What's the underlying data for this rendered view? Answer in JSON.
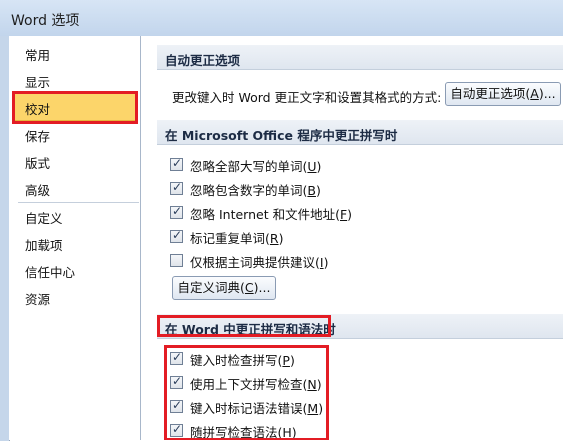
{
  "window": {
    "title": "Word 选项"
  },
  "nav": {
    "items": [
      {
        "label": "常用"
      },
      {
        "label": "显示"
      },
      {
        "label": "校对"
      },
      {
        "label": "保存"
      },
      {
        "label": "版式"
      },
      {
        "label": "高级"
      },
      {
        "label": "自定义"
      },
      {
        "label": "加载项"
      },
      {
        "label": "信任中心"
      },
      {
        "label": "资源"
      }
    ],
    "selected": "校对"
  },
  "autocorrect": {
    "header": "自动更正选项",
    "description": "更改键入时 Word 更正文字和设置其格式的方式:",
    "button": {
      "label": "自动更正选项(A)...",
      "text": "自动更正选项(",
      "key": "A",
      "tail": ")..."
    }
  },
  "office_spelling": {
    "header": "在 Microsoft Office 程序中更正拼写时",
    "options": [
      {
        "text": "忽略全部大写的单词(",
        "key": "U",
        "tail": ")",
        "checked": true
      },
      {
        "text": "忽略包含数字的单词(",
        "key": "B",
        "tail": ")",
        "checked": true
      },
      {
        "text": "忽略 Internet 和文件地址(",
        "key": "F",
        "tail": ")",
        "checked": true
      },
      {
        "text": "标记重复单词(",
        "key": "R",
        "tail": ")",
        "checked": true
      },
      {
        "text": "仅根据主词典提供建议(",
        "key": "I",
        "tail": ")",
        "checked": false
      }
    ],
    "dict_button": {
      "text": "自定义词典(",
      "key": "C",
      "tail": ")..."
    }
  },
  "word_spelling": {
    "header": "在 Word 中更正拼写和语法时",
    "options": [
      {
        "text": "键入时检查拼写(",
        "key": "P",
        "tail": ")",
        "checked": true
      },
      {
        "text": "使用上下文拼写检查(",
        "key": "N",
        "tail": ")",
        "checked": true
      },
      {
        "text": "键入时标记语法错误(",
        "key": "M",
        "tail": ")",
        "checked": true
      },
      {
        "text": "随拼写检查语法(",
        "key": "H",
        "tail": ")",
        "checked": true
      }
    ]
  }
}
